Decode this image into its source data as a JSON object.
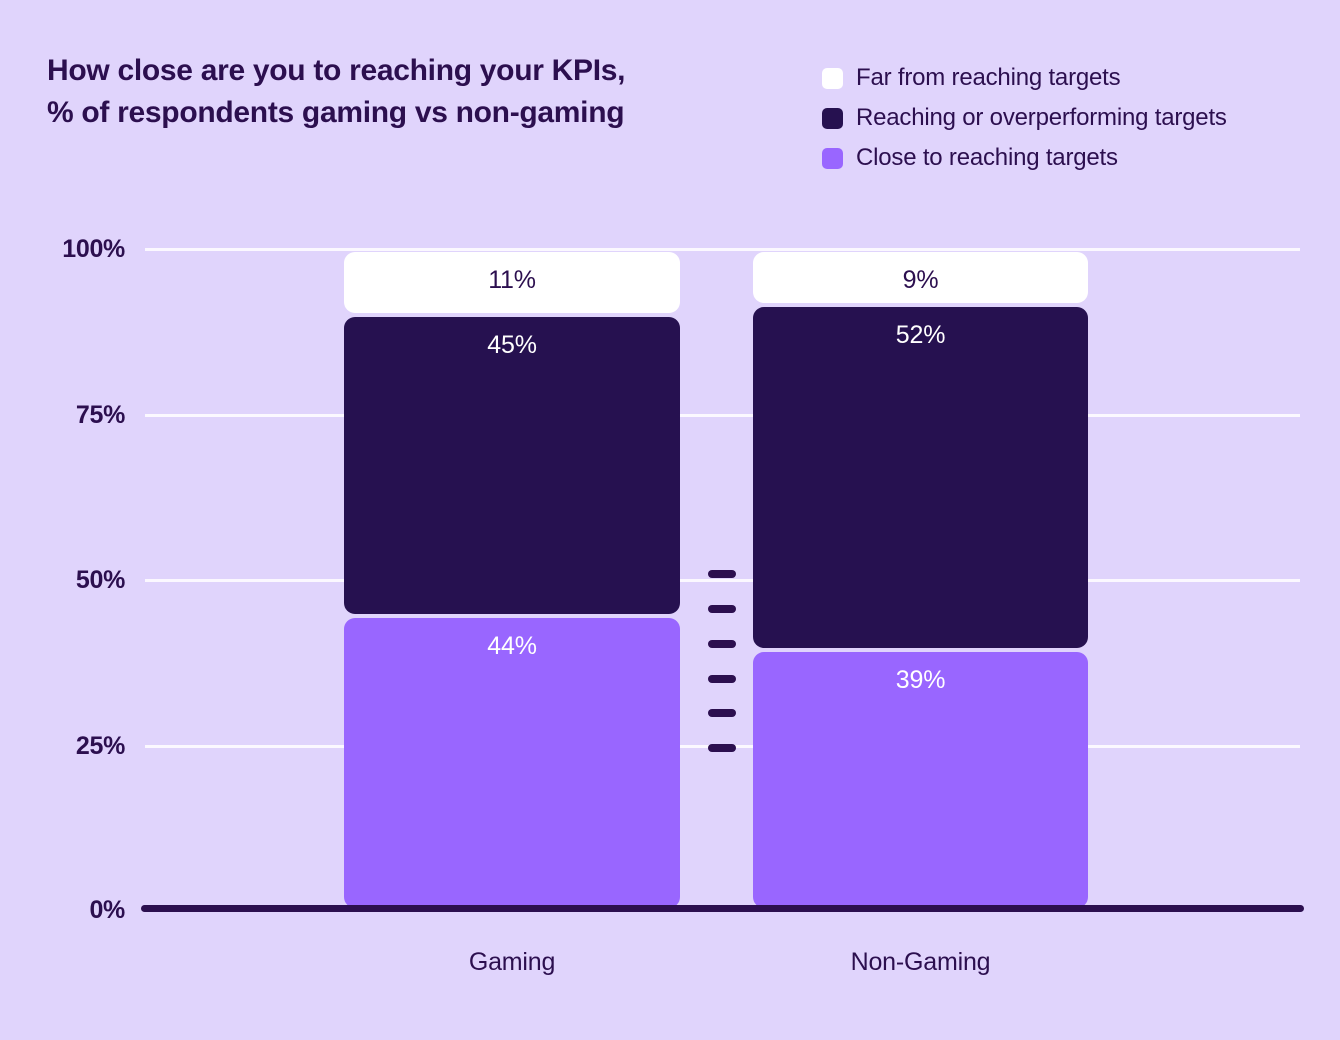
{
  "chart_data": {
    "type": "bar",
    "subtype": "stacked-bar-100",
    "title": "How close are you to reaching your KPIs, % of respondents gaming vs non-gaming",
    "title_lines": [
      "How close are you to reaching your KPIs,",
      "% of respondents gaming vs non-gaming"
    ],
    "xlabel": "",
    "ylabel": "",
    "categories": [
      "Gaming",
      "Non-Gaming"
    ],
    "ylim": [
      0,
      100
    ],
    "ytick_labels": [
      "100%",
      "75%",
      "50%",
      "25%",
      "0%"
    ],
    "ytick_values": [
      100,
      75,
      50,
      25,
      0
    ],
    "grid": true,
    "legend_position": "top-right",
    "series": [
      {
        "name": "Far from reaching targets",
        "color": "#ffffff",
        "label_color": "#2c0f4f",
        "values": [
          11,
          9
        ],
        "value_labels": [
          "11%",
          "9%"
        ]
      },
      {
        "name": "Reaching or overperforming targets",
        "color": "#261150",
        "label_color": "#ffffff",
        "values": [
          45,
          52
        ],
        "value_labels": [
          "45%",
          "52%"
        ]
      },
      {
        "name": "Close to reaching targets",
        "color": "#9966ff",
        "label_color": "#ffffff",
        "values": [
          44,
          39
        ],
        "value_labels": [
          "44%",
          "39%"
        ]
      }
    ],
    "colors": {
      "background": "#e0d4fc",
      "gridline": "#fbf8ff",
      "axis": "#2c0f4f",
      "text": "#2c0f4f",
      "far_from_targets": "#ffffff",
      "reaching_targets": "#261150",
      "close_to_targets": "#9966ff"
    }
  },
  "legend": {
    "items": [
      {
        "label": "Far from reaching targets",
        "color": "#ffffff"
      },
      {
        "label": "Reaching or overperforming targets",
        "color": "#261150"
      },
      {
        "label": "Close to reaching targets",
        "color": "#9966ff"
      }
    ]
  },
  "divider": {
    "dash_count": 6,
    "color": "#2c0f4f"
  }
}
